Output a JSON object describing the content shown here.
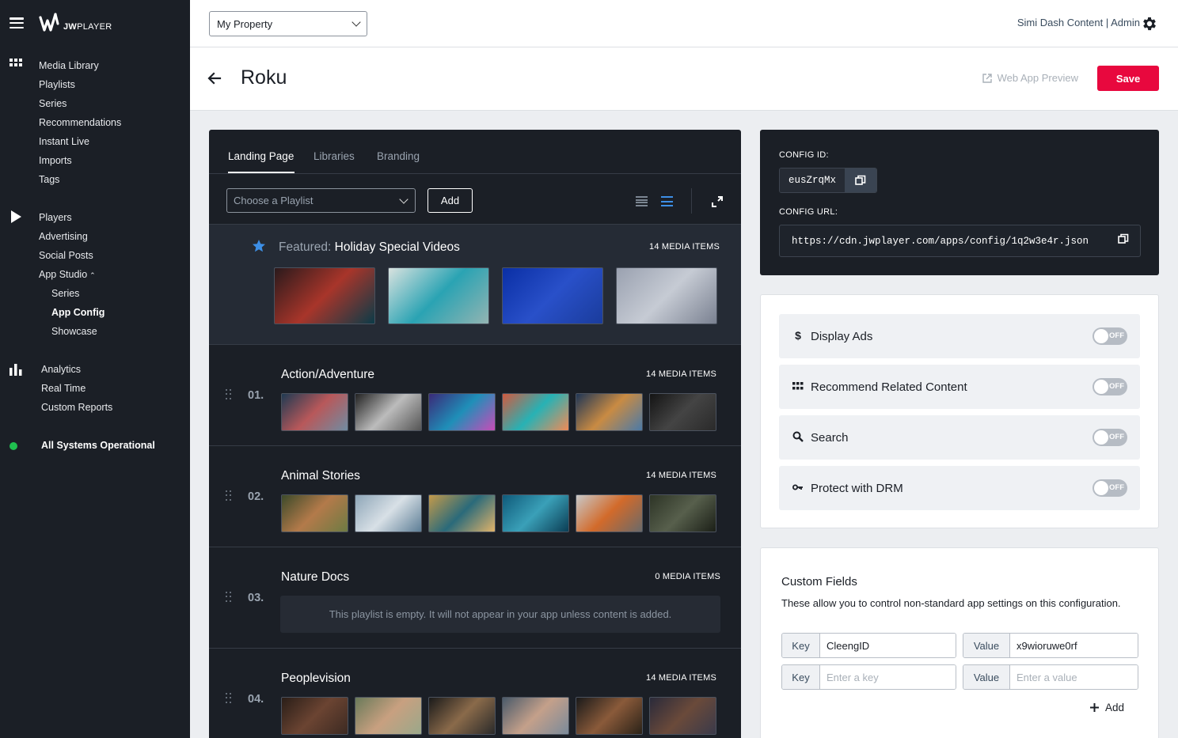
{
  "brand": {
    "name_bold": "JW",
    "name_rest": "PLAYER"
  },
  "sidebar": {
    "media": [
      "Media Library",
      "Playlists",
      "Series",
      "Recommendations",
      "Instant Live",
      "Imports",
      "Tags"
    ],
    "players": [
      "Players",
      "Advertising",
      "Social Posts",
      "App Studio"
    ],
    "app_studio_caret": "⌃",
    "app_studio_sub": [
      "Series",
      "App Config",
      "Showcase"
    ],
    "analytics": [
      "Analytics",
      "Real Time",
      "Custom Reports"
    ],
    "status": "All Systems Operational",
    "status_color": "#1fbf4f"
  },
  "header": {
    "property_select": "My Property",
    "user": "Simi Dash Content  |  Admin"
  },
  "page": {
    "title": "Roku",
    "preview_link": "Web App Preview",
    "save_label": "Save",
    "accent_color": "#e8083e"
  },
  "editor": {
    "tabs": [
      "Landing Page",
      "Libraries",
      "Branding"
    ],
    "playlist_placeholder": "Choose a Playlist",
    "add_label": "Add",
    "featured": {
      "label": "Featured:",
      "title": "Holiday Special Videos",
      "count": "14 MEDIA ITEMS",
      "thumbs": [
        [
          "#2a1a1c",
          "#a8352a",
          "#0b3b48"
        ],
        [
          "#d9e2df",
          "#2aa3b3",
          "#93b4b2"
        ],
        [
          "#0a2fa5",
          "#2950c9",
          "#1a3c9c"
        ],
        [
          "#9aa1b0",
          "#c6cbd4",
          "#7a8191"
        ]
      ]
    },
    "rows": [
      {
        "num": "01.",
        "title": "Action/Adventure",
        "count": "14 MEDIA ITEMS",
        "thumbs": [
          [
            "#1f3a52",
            "#b8585a",
            "#6f8ca2"
          ],
          [
            "#222",
            "#bcbcbc",
            "#555"
          ],
          [
            "#3b2a78",
            "#1f8fb8",
            "#c84cb8"
          ],
          [
            "#d15a3f",
            "#27b2b5",
            "#f08a56"
          ],
          [
            "#1f3656",
            "#c98b43",
            "#4b7aa8"
          ],
          [
            "#141414",
            "#444",
            "#2a2a2a"
          ]
        ]
      },
      {
        "num": "02.",
        "title": "Animal Stories",
        "count": "14 MEDIA ITEMS",
        "thumbs": [
          [
            "#3c4a2a",
            "#b37a4a",
            "#6d7b43"
          ],
          [
            "#8ea6b8",
            "#d8e0e6",
            "#5d7e96"
          ],
          [
            "#c49a4a",
            "#2a6a7a",
            "#e0b36a"
          ],
          [
            "#0f5a7a",
            "#3aa0b8",
            "#0b3d54"
          ],
          [
            "#c8c8c8",
            "#d26a2a",
            "#6a6a6a"
          ],
          [
            "#2d3426",
            "#575f4c",
            "#1b1f17"
          ]
        ]
      },
      {
        "num": "03.",
        "title": "Nature Docs",
        "count": "0 MEDIA ITEMS",
        "empty": "This playlist is empty. It will not appear in your app unless content is added."
      },
      {
        "num": "04.",
        "title": "Peoplevision",
        "count": "14 MEDIA ITEMS",
        "thumbs": [
          [
            "#2a1e18",
            "#6b4432",
            "#3c2a22"
          ],
          [
            "#6a7a5a",
            "#c8a080",
            "#9aa88a"
          ],
          [
            "#1a1a1a",
            "#8a6a4a",
            "#2a2a2a"
          ],
          [
            "#4a5a6a",
            "#c4a08a",
            "#7a8a9a"
          ],
          [
            "#1a1a1a",
            "#8a5a3a",
            "#2a2218"
          ],
          [
            "#2a2a3a",
            "#6a4a3a",
            "#3a3a4a"
          ]
        ]
      }
    ]
  },
  "config": {
    "id_label": "CONFIG ID:",
    "id_value": "eusZrqMx",
    "url_label": "CONFIG URL:",
    "url_value": "https://cdn.jwplayer.com/apps/config/1q2w3e4r.json"
  },
  "features": [
    {
      "label": "Display Ads",
      "icon": "dollar-icon",
      "state": "OFF"
    },
    {
      "label": "Recommend Related Content",
      "icon": "grid-icon",
      "state": "OFF"
    },
    {
      "label": "Search",
      "icon": "search-icon",
      "state": "OFF"
    },
    {
      "label": "Protect with DRM",
      "icon": "key-icon",
      "state": "OFF"
    }
  ],
  "custom_fields": {
    "title": "Custom Fields",
    "description": "These allow you to control non-standard app settings on this configuration.",
    "key_label": "Key",
    "value_label": "Value",
    "rows": [
      {
        "key": "CleengID",
        "value": "x9wioruwe0rf"
      },
      {
        "key": "",
        "value": "",
        "key_placeholder": "Enter a key",
        "value_placeholder": "Enter a value"
      }
    ],
    "add_label": "Add"
  }
}
